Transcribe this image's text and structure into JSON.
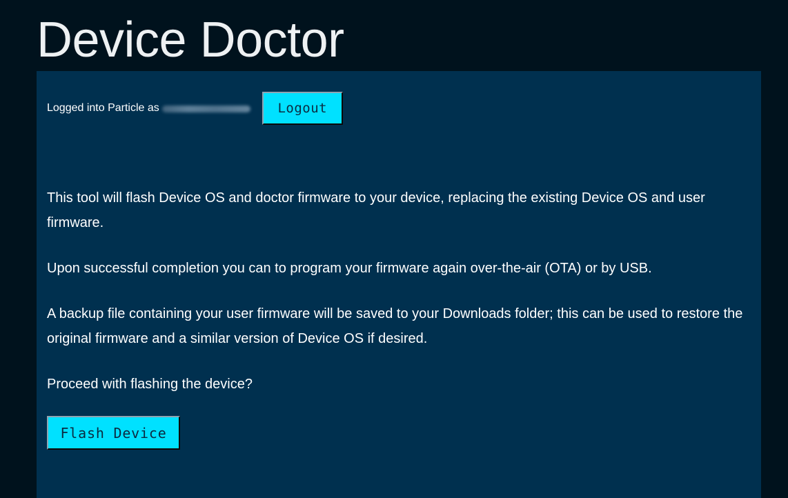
{
  "header": {
    "title": "Device Doctor"
  },
  "account": {
    "logged_in_label": "Logged into Particle as",
    "logout_label": "Logout"
  },
  "intro": {
    "paragraphs": [
      "This tool will flash Device OS and doctor firmware to your device, replacing the existing Device OS and user firmware.",
      "Upon successful completion you can to program your firmware again over-the-air (OTA) or by USB.",
      "A backup file containing your user firmware will be saved to your Downloads folder; this can be used to restore the original firmware and a similar version of Device OS if desired.",
      "Proceed with flashing the device?"
    ]
  },
  "actions": {
    "flash_label": "Flash Device"
  },
  "colors": {
    "page_background": "#00121d",
    "panel_background": "#00304f",
    "button_background": "#00e1ff",
    "button_text": "#0b2a40"
  }
}
